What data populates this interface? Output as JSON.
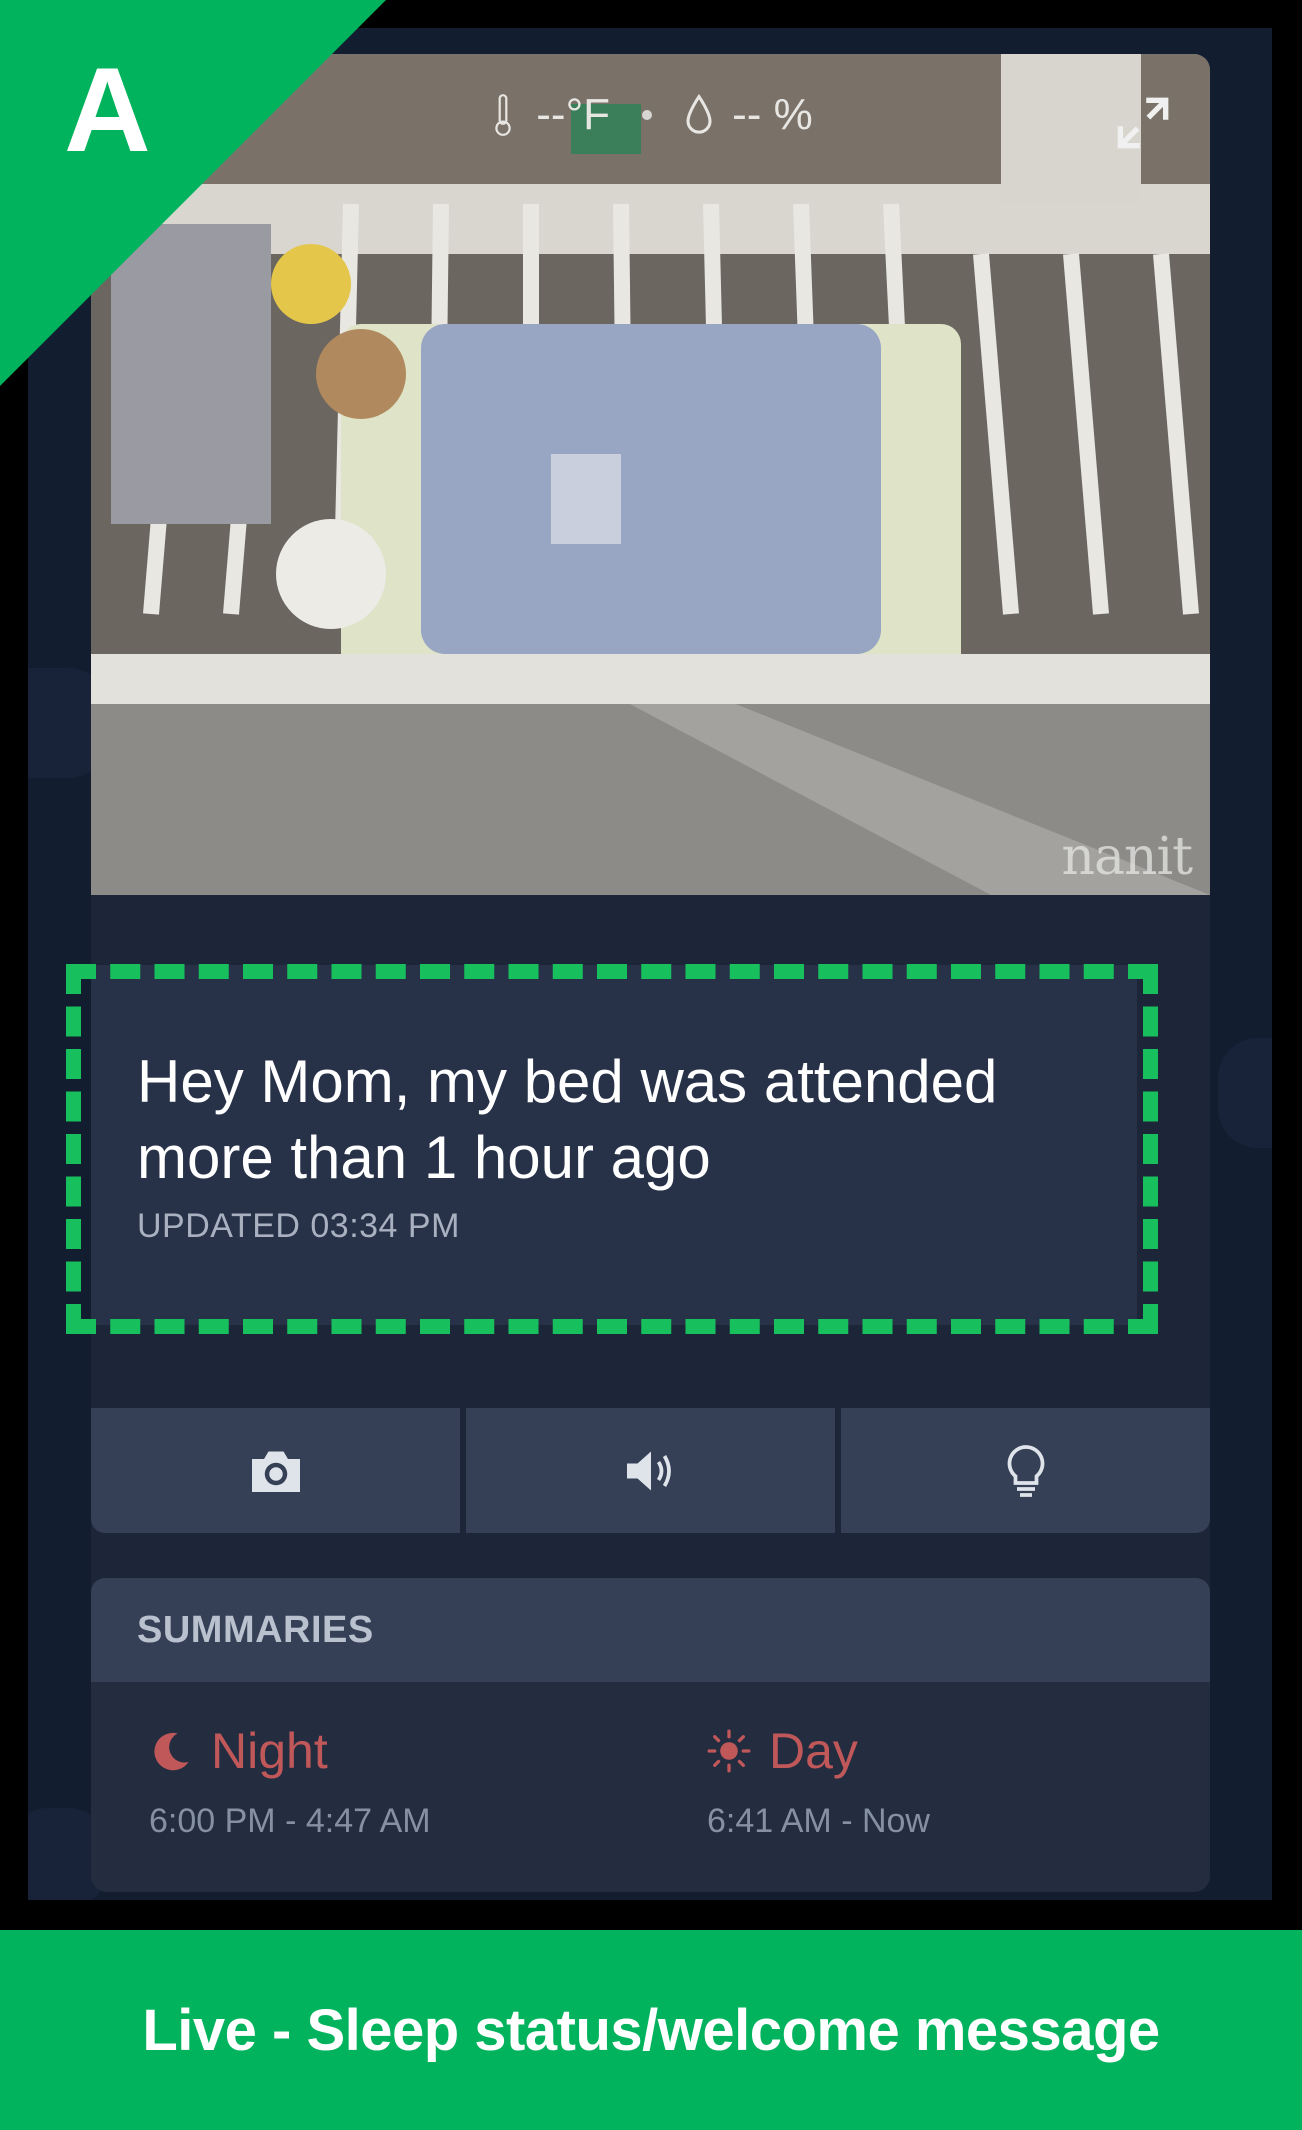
{
  "badge": {
    "letter": "A"
  },
  "camera": {
    "temperature": "--°F",
    "humidity": "-- %",
    "watermark": "nanit"
  },
  "message": {
    "title": "Hey Mom, my bed was attended more than 1 hour ago",
    "updated": "UPDATED 03:34 PM"
  },
  "actions": [
    {
      "icon": "camera-icon"
    },
    {
      "icon": "speaker-icon"
    },
    {
      "icon": "lightbulb-icon"
    }
  ],
  "summaries": {
    "heading": "SUMMARIES",
    "night": {
      "label": "Night",
      "time": "6:00 PM - 4:47 AM",
      "icon": "moon-icon"
    },
    "day": {
      "label": "Day",
      "time": "6:41 AM - Now",
      "icon": "sun-icon"
    }
  },
  "caption": "Live - Sleep status/welcome message",
  "colors": {
    "accent_green": "#17c05c",
    "summary_red": "#c0585a",
    "card_bg": "#273249"
  }
}
